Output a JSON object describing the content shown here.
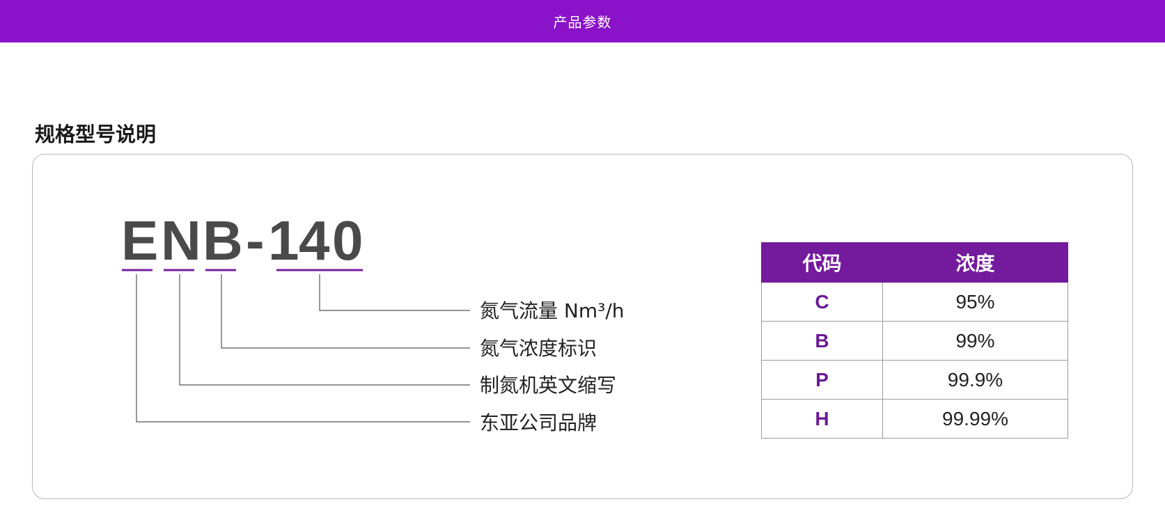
{
  "header": {
    "title": "产品参数"
  },
  "section": {
    "title": "规格型号说明"
  },
  "model": {
    "segments": [
      "E",
      "N",
      "B",
      "-",
      "1",
      "4",
      "0"
    ],
    "underline_color": "#7a1fa2"
  },
  "descriptions": [
    {
      "text": "氮气流量 Nm³/h",
      "refers_to": "140"
    },
    {
      "text": "氮气浓度标识",
      "refers_to": "B"
    },
    {
      "text": "制氮机英文缩写",
      "refers_to": "N"
    },
    {
      "text": "东亚公司品牌",
      "refers_to": "E"
    }
  ],
  "table": {
    "headers": [
      "代码",
      "浓度"
    ],
    "rows": [
      {
        "code": "C",
        "concentration": "95%"
      },
      {
        "code": "B",
        "concentration": "99%"
      },
      {
        "code": "P",
        "concentration": "99.9%"
      },
      {
        "code": "H",
        "concentration": "99.99%"
      }
    ]
  },
  "colors": {
    "topbar": "#8a12c9",
    "table_header": "#741a9c",
    "code_text": "#6a1b93",
    "model_text": "#4a4a4a"
  }
}
